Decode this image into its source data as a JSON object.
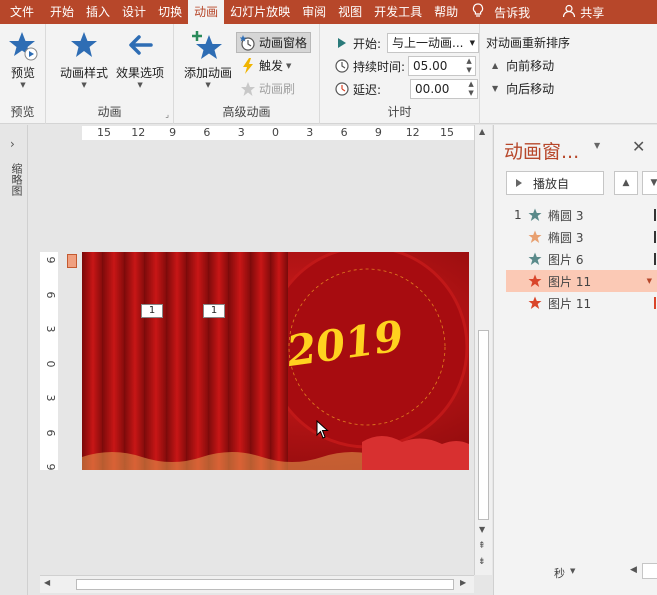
{
  "menubar": {
    "tabs": [
      {
        "label": "文件",
        "active": false
      },
      {
        "label": "开始",
        "active": false
      },
      {
        "label": "插入",
        "active": false
      },
      {
        "label": "设计",
        "active": false
      },
      {
        "label": "切换",
        "active": false
      },
      {
        "label": "动画",
        "active": true
      },
      {
        "label": "幻灯片放映",
        "active": false
      },
      {
        "label": "审阅",
        "active": false
      },
      {
        "label": "视图",
        "active": false
      },
      {
        "label": "开发工具",
        "active": false
      },
      {
        "label": "帮助",
        "active": false
      }
    ],
    "tell_me": "告诉我",
    "share": "共享"
  },
  "ribbon": {
    "preview_group": {
      "button": "预览",
      "label": "预览"
    },
    "animation_group": {
      "styles": "动画样式",
      "effects": "效果选项",
      "label": "动画"
    },
    "advanced_group": {
      "add": "添加动画",
      "pane": "动画窗格",
      "trigger": "触发",
      "painter": "动画刷",
      "label": "高级动画"
    },
    "timing_group": {
      "start_label": "开始:",
      "start_value": "与上一动画...",
      "duration_label": "持续时间:",
      "duration_value": "05.00",
      "delay_label": "延迟:",
      "delay_value": "00.00",
      "label": "计时"
    },
    "reorder_group": {
      "title": "对动画重新排序",
      "forward": "向前移动",
      "backward": "向后移动"
    }
  },
  "thumbs": {
    "label": "缩略图"
  },
  "rulers": {
    "h": [
      "15",
      "12",
      "9",
      "6",
      "3",
      "0",
      "3",
      "6",
      "9",
      "12",
      "15"
    ],
    "v": [
      "9",
      "6",
      "3",
      "0",
      "3",
      "6",
      "9"
    ]
  },
  "slide": {
    "tags": [
      "1",
      "1"
    ],
    "year_text": "2019"
  },
  "pane": {
    "title": "动画窗...",
    "play_label": "播放自",
    "items": [
      {
        "num": "1",
        "name": "椭圆 3",
        "star_color": "#5a8a8a",
        "selected": false
      },
      {
        "num": "",
        "name": "椭圆 3",
        "star_color": "#e8a070",
        "selected": false
      },
      {
        "num": "",
        "name": "图片 6",
        "star_color": "#5a8a8a",
        "selected": false
      },
      {
        "num": "",
        "name": "图片 11",
        "star_color": "#d9452a",
        "selected": true
      },
      {
        "num": "",
        "name": "图片 11",
        "star_color": "#d9452a",
        "selected": false
      }
    ],
    "seconds": "秒"
  },
  "colors": {
    "accent": "#b7472a",
    "selected_row": "#fbc9b5"
  }
}
